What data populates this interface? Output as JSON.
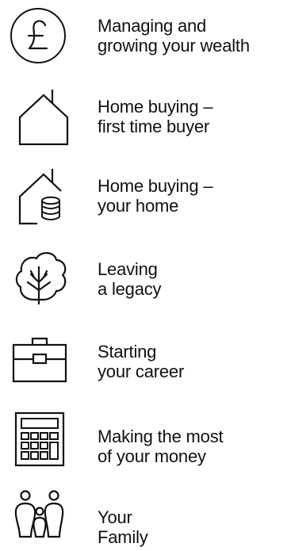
{
  "items": [
    {
      "icon": "pound-coin-icon",
      "line1": "Managing and",
      "line2": "growing your wealth"
    },
    {
      "icon": "house-icon",
      "line1": "Home buying –",
      "line2": "first time buyer"
    },
    {
      "icon": "house-coins-icon",
      "line1": "Home buying –",
      "line2": "your home"
    },
    {
      "icon": "tree-icon",
      "line1": "Leaving",
      "line2": "a legacy"
    },
    {
      "icon": "briefcase-icon",
      "line1": "Starting",
      "line2": "your career"
    },
    {
      "icon": "calculator-icon",
      "line1": "Making the most",
      "line2": "of your money"
    },
    {
      "icon": "family-icon",
      "line1": "Your",
      "line2": "Family"
    }
  ]
}
